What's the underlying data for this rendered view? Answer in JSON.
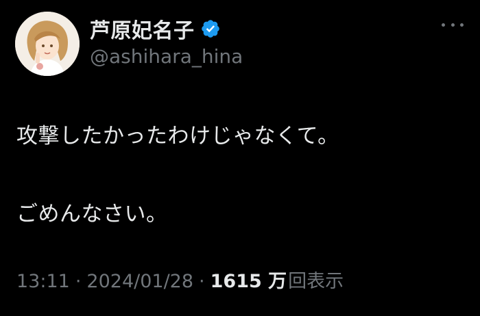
{
  "author": {
    "display_name": "芦原妃名子",
    "handle": "@ashihara_hina",
    "verified": true,
    "verified_color": "#1d9bf0"
  },
  "menu": {
    "icon": "more-horizontal-icon"
  },
  "tweet": {
    "line1": "攻撃したかったわけじゃなくて。",
    "line2": "ごめんなさい。"
  },
  "meta": {
    "time": "13:11",
    "separator": "·",
    "date": "2024/01/28",
    "views_count": "1615 万",
    "views_label": "回表示"
  },
  "colors": {
    "background": "#000000",
    "primary_text": "#e7e9ea",
    "secondary_text": "#71767b"
  }
}
